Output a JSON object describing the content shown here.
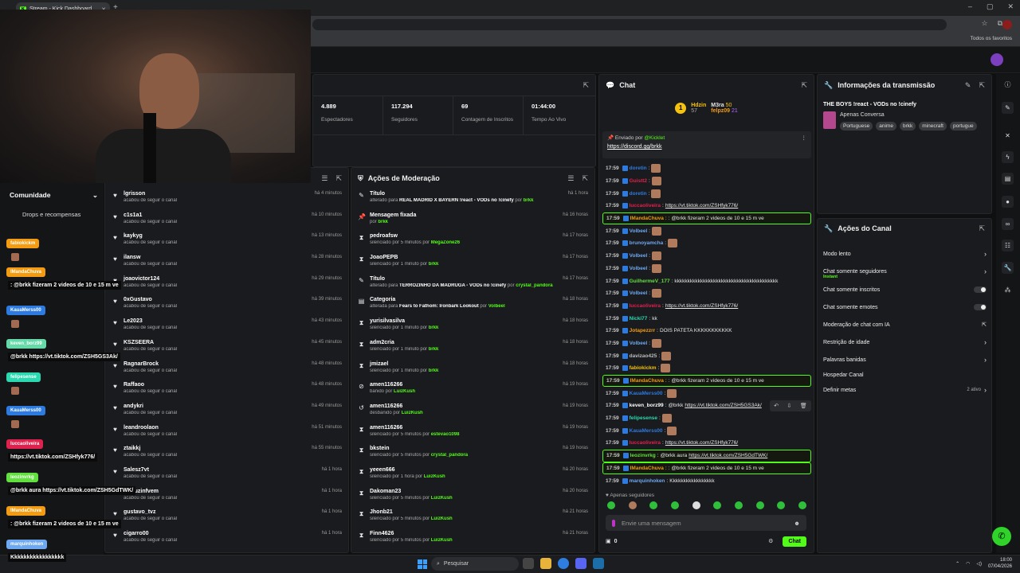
{
  "browser": {
    "tab_title": "Stream - Kick Dashboard",
    "new_tab_icon": "+",
    "window_controls": [
      "–",
      "▢",
      "✕"
    ],
    "bookmarks_all": "Todos os favoritos"
  },
  "overlay": {
    "comunidade": "Comunidade",
    "drops": "Drops e recompensas",
    "entries": [
      {
        "name": "fabiokickm",
        "color": "#f39c12",
        "msg": ""
      },
      {
        "name": "IMandaChuva",
        "color": "#f39c12",
        "msg": ": @brkk fizeram 2 videos de 10 e 15 m ve"
      },
      {
        "name": "KauaMerss00",
        "color": "#2d7be0",
        "msg": ""
      },
      {
        "name": "keven_borz99",
        "color": "#66d9a8",
        "msg": "@brkk https://vt.tiktok.com/ZSH5GS3Ak/"
      },
      {
        "name": "felipesense",
        "color": "#2bd9b0",
        "msg": ""
      },
      {
        "name": "KauaMerss00",
        "color": "#2d7be0",
        "msg": ""
      },
      {
        "name": "luccaoliveira",
        "color": "#e0214d",
        "msg": "https://vt.tiktok.com/ZSHfyk776/"
      },
      {
        "name": "leozinvrkg",
        "color": "#62e040",
        "msg": "@brkk aura https://vt.tiktok.com/ZSH5GdTWK/"
      },
      {
        "name": "IMandaChuva",
        "color": "#f39c12",
        "msg": ": @brkk fizeram 2 videos de 10 e 15 m ve"
      },
      {
        "name": "marquinhoken",
        "color": "#6ea8f0",
        "msg": "Kkkkkkkkkkkkkkkkk"
      }
    ]
  },
  "stats": {
    "items": [
      {
        "value": "4.889",
        "label": "Espectadores"
      },
      {
        "value": "117.294",
        "label": "Seguidores"
      },
      {
        "value": "69",
        "label": "Contagem de Inscritos"
      },
      {
        "value": "01:44:00",
        "label": "Tempo Ao Vivo"
      }
    ]
  },
  "feed": {
    "rows": [
      {
        "name": "lgrisson",
        "desc": "acabou de seguir o canal",
        "time": "há 4 minutos"
      },
      {
        "name": "c1s1a1",
        "desc": "acabou de seguir o canal",
        "time": "há 10 minutos"
      },
      {
        "name": "kaykyg",
        "desc": "acabou de seguir o canal",
        "time": "há 13 minutos"
      },
      {
        "name": "ilansw",
        "desc": "acabou de seguir o canal",
        "time": "há 28 minutos"
      },
      {
        "name": "joaovictor124",
        "desc": "acabou de seguir o canal",
        "time": "há 29 minutos"
      },
      {
        "name": "0xGustavo",
        "desc": "acabou de seguir o canal",
        "time": "há 39 minutos"
      },
      {
        "name": "Le2023",
        "desc": "acabou de seguir o canal",
        "time": "há 43 minutos"
      },
      {
        "name": "KSZSEERA",
        "desc": "acabou de seguir o canal",
        "time": "há 45 minutos"
      },
      {
        "name": "RagnarBrock",
        "desc": "acabou de seguir o canal",
        "time": "há 48 minutos"
      },
      {
        "name": "Raffaoo",
        "desc": "acabou de seguir o canal",
        "time": "há 48 minutos"
      },
      {
        "name": "andykri",
        "desc": "acabou de seguir o canal",
        "time": "há 49 minutos"
      },
      {
        "name": "leandroolaon",
        "desc": "acabou de seguir o canal",
        "time": "há 51 minutos"
      },
      {
        "name": "ztaikkj",
        "desc": "acabou de seguir o canal",
        "time": "há 55 minutos"
      },
      {
        "name": "Salesz7vt",
        "desc": "acabou de seguir o canal",
        "time": "há 1 hora"
      },
      {
        "name": "Duduzinfvem",
        "desc": "acabou de seguir o canal",
        "time": "há 1 hora"
      },
      {
        "name": "gustavo_tvz",
        "desc": "acabou de seguir o canal",
        "time": "há 1 hora"
      },
      {
        "name": "cigarro00",
        "desc": "acabou de seguir o canal",
        "time": "há 1 hora"
      }
    ]
  },
  "moderation": {
    "title": "Ações de Moderação",
    "rows": [
      {
        "icon": "✎",
        "name": "Título",
        "pre": "alterado para ",
        "bold": "REAL MADRID X BAYERN !react - VODs no !cinefy",
        "mid": " por ",
        "green": "brkk",
        "time": "há 1 hora"
      },
      {
        "icon": "📌",
        "name": "Mensagem fixada",
        "pre": "por ",
        "bold": "",
        "mid": "",
        "green": "brkk",
        "time": "há 16 horas"
      },
      {
        "icon": "⧗",
        "name": "pedroafsw",
        "pre": "silenciado por 5 minutos por ",
        "bold": "",
        "mid": "",
        "green": "MegaZone26",
        "time": "há 17 horas"
      },
      {
        "icon": "⧗",
        "name": "JoaoPEPB",
        "pre": "silenciado por 1 minuto por ",
        "bold": "",
        "mid": "",
        "green": "brkk",
        "time": "há 17 horas"
      },
      {
        "icon": "✎",
        "name": "Título",
        "pre": "alterado para ",
        "bold": "TERROZINHO DA MADRUGA - VODs no !cinefy",
        "mid": " por ",
        "green": "crystal_pandora",
        "time": "há 17 horas"
      },
      {
        "icon": "▤",
        "name": "Categoria",
        "pre": "alterada para ",
        "bold": "Fears to Fathom: Ironbark Lookout",
        "mid": " por ",
        "green": "Volbeel",
        "time": "há 18 horas"
      },
      {
        "icon": "⧗",
        "name": "yurisilvasilva",
        "pre": "silenciado por 1 minuto por ",
        "bold": "",
        "mid": "",
        "green": "brkk",
        "time": "há 18 horas"
      },
      {
        "icon": "⧗",
        "name": "adm2cria",
        "pre": "silenciado por 1 minuto por ",
        "bold": "",
        "mid": "",
        "green": "brkk",
        "time": "há 18 horas"
      },
      {
        "icon": "⧗",
        "name": "jmizael",
        "pre": "silenciado por 1 minuto por ",
        "bold": "",
        "mid": "",
        "green": "brkk",
        "time": "há 18 horas"
      },
      {
        "icon": "⊘",
        "name": "amen116266",
        "pre": "banido por ",
        "bold": "",
        "mid": "",
        "green": "LuizKush",
        "time": "há 19 horas"
      },
      {
        "icon": "↺",
        "name": "amen116266",
        "pre": "desbanido por ",
        "bold": "",
        "mid": "",
        "green": "LuizKush",
        "time": "há 19 horas"
      },
      {
        "icon": "⧗",
        "name": "amen116266",
        "pre": "silenciado por 5 minutos por ",
        "bold": "",
        "mid": "",
        "green": "estevao1098",
        "time": "há 19 horas"
      },
      {
        "icon": "⧗",
        "name": "bkstein",
        "pre": "silenciado por 5 minutos por ",
        "bold": "",
        "mid": "",
        "green": "crystal_pandora",
        "time": "há 19 horas"
      },
      {
        "icon": "⧗",
        "name": "yeeen666",
        "pre": "silenciado por 1 hora por ",
        "bold": "",
        "mid": "",
        "green": "LuizKush",
        "time": "há 20 horas"
      },
      {
        "icon": "⧗",
        "name": "Dakoman23",
        "pre": "silenciado por 5 minutos por ",
        "bold": "",
        "mid": "",
        "green": "LuizKush",
        "time": "há 20 horas"
      },
      {
        "icon": "⧗",
        "name": "Jhonb21",
        "pre": "silenciado por 5 minutos por ",
        "bold": "",
        "mid": "",
        "green": "LuizKush",
        "time": "há 21 horas"
      },
      {
        "icon": "⧗",
        "name": "Finn4626",
        "pre": "silenciado por 5 minutos por ",
        "bold": "",
        "mid": "",
        "green": "LuizKush",
        "time": "há 21 horas"
      }
    ]
  },
  "chat": {
    "title": "Chat",
    "leaderboard": {
      "rank": "1",
      "first": "Hdzin",
      "first_score": "57",
      "second": "M3ra",
      "second_score": "50",
      "third": "felpz09",
      "third_score": "21"
    },
    "pinned": {
      "by_label": "Enviado por",
      "by_user": "@Kicklet",
      "link": "https://discord.gg/brkk"
    },
    "messages": [
      {
        "ts": "17:59",
        "user": "doretin",
        "color": "#2d7be0",
        "text": "",
        "link": "",
        "emote": true,
        "hl": false
      },
      {
        "ts": "17:59",
        "user": "Guistt2",
        "color": "#e0214d",
        "text": "",
        "link": "",
        "emote": true,
        "hl": false
      },
      {
        "ts": "17:59",
        "user": "doretin",
        "color": "#2d7be0",
        "text": "",
        "link": "",
        "emote": true,
        "hl": false
      },
      {
        "ts": "17:59",
        "user": "luccaoliveira",
        "color": "#e0214d",
        "text": "",
        "link": "https://vt.tiktok.com/ZSHfyk776/",
        "emote": false,
        "hl": false
      },
      {
        "ts": "17:59",
        "user": "IMandaChuva",
        "color": "#f39c12",
        "text": ": @brkk fizeram 2 videos de 10 e 15 m ve",
        "link": "",
        "emote": false,
        "hl": true
      },
      {
        "ts": "17:59",
        "user": "Volbeel",
        "color": "#6ea8f0",
        "text": "",
        "link": "",
        "emote": true,
        "hl": false
      },
      {
        "ts": "17:59",
        "user": "brunoyamcha",
        "color": "#6ea8f0",
        "text": "",
        "link": "",
        "emote": true,
        "hl": false
      },
      {
        "ts": "17:59",
        "user": "Volbeel",
        "color": "#6ea8f0",
        "text": "",
        "link": "",
        "emote": true,
        "hl": false
      },
      {
        "ts": "17:59",
        "user": "Volbeel",
        "color": "#6ea8f0",
        "text": "",
        "link": "",
        "emote": true,
        "hl": false
      },
      {
        "ts": "17:59",
        "user": "GuilhermeV_177",
        "color": "#62e040",
        "text": "kkkkkkkkkkkkkkkkkkkkkkkkkkkkkkkkkkkkkkkk",
        "link": "",
        "emote": false,
        "hl": false
      },
      {
        "ts": "17:59",
        "user": "Volbeel",
        "color": "#6ea8f0",
        "text": "",
        "link": "",
        "emote": true,
        "hl": false
      },
      {
        "ts": "17:59",
        "user": "luccaoliveira",
        "color": "#e0214d",
        "text": "",
        "link": "https://vt.tiktok.com/ZSHfyk776/",
        "emote": false,
        "hl": false
      },
      {
        "ts": "17:59",
        "user": "Nicki77",
        "color": "#2bd9b0",
        "text": "kk",
        "link": "",
        "emote": false,
        "hl": false
      },
      {
        "ts": "17:59",
        "user": "Jotapezzrr",
        "color": "#f39c12",
        "text": "DOIS PATETA KKKKKKKKKKK",
        "link": "",
        "emote": false,
        "hl": false
      },
      {
        "ts": "17:59",
        "user": "Volbeel",
        "color": "#6ea8f0",
        "text": "",
        "link": "",
        "emote": true,
        "hl": false
      },
      {
        "ts": "17:59",
        "user": "davizao425",
        "color": "#bbbbbb",
        "text": "",
        "link": "",
        "emote": true,
        "hl": false
      },
      {
        "ts": "17:59",
        "user": "fabiokickm",
        "color": "#f3c10e",
        "text": "",
        "link": "",
        "emote": true,
        "hl": false
      },
      {
        "ts": "17:59",
        "user": "IMandaChuva",
        "color": "#f39c12",
        "text": ": @brkk fizeram 2 videos de 10 e 15 m ve",
        "link": "",
        "emote": false,
        "hl": true
      },
      {
        "ts": "17:59",
        "user": "KauaMerss00",
        "color": "#2d7be0",
        "text": "",
        "link": "",
        "emote": true,
        "hl": false
      },
      {
        "ts": "17:59",
        "user": "keven_borz99",
        "color": "#ffffff",
        "text": "@brkk",
        "link": "https://vt.tiktok.com/ZSH5GS3Ak/",
        "emote": false,
        "hl": false
      },
      {
        "ts": "17:59",
        "user": "felipesense",
        "color": "#2bd9b0",
        "text": "",
        "link": "",
        "emote": true,
        "hl": false
      },
      {
        "ts": "17:59",
        "user": "KauaMerss00",
        "color": "#2d7be0",
        "text": "",
        "link": "",
        "emote": true,
        "hl": false
      },
      {
        "ts": "17:59",
        "user": "luccaoliveira",
        "color": "#e0214d",
        "text": "",
        "link": "https://vt.tiktok.com/ZSHfyk776/",
        "emote": false,
        "hl": false
      },
      {
        "ts": "17:59",
        "user": "leozinvrkg",
        "color": "#62e040",
        "text": "@brkk aura",
        "link": "https://vt.tiktok.com/ZSH5GdTWK/",
        "emote": false,
        "hl": true
      },
      {
        "ts": "17:59",
        "user": "IMandaChuva",
        "color": "#f39c12",
        "text": ": @brkk fizeram 2 videos de 10 e 15 m ve",
        "link": "",
        "emote": false,
        "hl": true
      },
      {
        "ts": "17:59",
        "user": "marquinhoken",
        "color": "#6ea8f0",
        "text": "Kkkkkkkkkkkkkkkkk",
        "link": "",
        "emote": false,
        "hl": false
      }
    ],
    "followers_only": "Apenas seguidores",
    "input_placeholder": "Envie uma mensagem",
    "count": "0",
    "send_label": "Chat"
  },
  "info": {
    "title": "Informações da transmissão",
    "stream_title": "THE BOYS !react - VODs no !cinefy",
    "category": "Apenas Conversa",
    "tags": [
      "Portuguese",
      "anime",
      "brkk",
      "minecraft",
      "portugue"
    ]
  },
  "channel_actions": {
    "title": "Ações do Canal",
    "rows": [
      {
        "label": "Modo lento",
        "sub": "",
        "control": "chevron"
      },
      {
        "label": "Chat somente seguidores",
        "sub": "Instant",
        "control": "chevron"
      },
      {
        "label": "Chat somente inscritos",
        "sub": "",
        "control": "toggle"
      },
      {
        "label": "Chat somente emotes",
        "sub": "",
        "control": "toggle"
      },
      {
        "label": "Moderação de chat com IA",
        "sub": "",
        "control": "external"
      },
      {
        "label": "Restrição de idade",
        "sub": "",
        "control": "chevron"
      },
      {
        "label": "Palavras banidas",
        "sub": "",
        "control": "chevron"
      },
      {
        "label": "Hospedar Canal",
        "sub": "",
        "control": "none"
      },
      {
        "label": "Definir metas",
        "sub": "",
        "control": "chevron"
      }
    ],
    "metas_status": "2 ativo"
  },
  "taskbar": {
    "search": "Pesquisar",
    "time": "18:00",
    "date": "07/04/2026"
  }
}
